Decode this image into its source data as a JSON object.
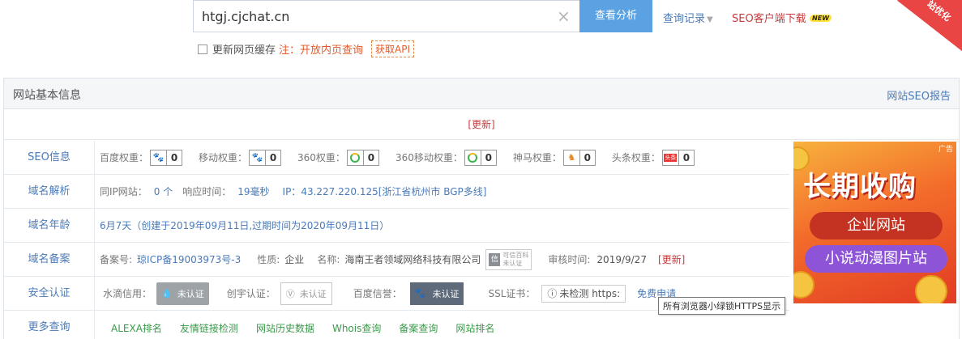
{
  "search": {
    "value": "htgj.cjchat.cn",
    "analyze_label": "查看分析",
    "history_label": "查询记录",
    "seo_client_label": "SEO客户端下载",
    "new_badge": "NEW",
    "corner_label": "站优化"
  },
  "options": {
    "refresh_cache_label": "更新网页缓存",
    "note": "注：开放内页查询",
    "api_label": "获取API"
  },
  "panel": {
    "title": "网站基本信息",
    "seo_report": "网站SEO报告",
    "update_label": "[更新]"
  },
  "seo": {
    "label": "SEO信息",
    "items": [
      {
        "name": "百度权重：",
        "value": "0",
        "icon": "baidu-paw-icon"
      },
      {
        "name": "移动权重：",
        "value": "0",
        "icon": "baidu-paw-icon"
      },
      {
        "name": "360权重：",
        "value": "0",
        "icon": "360-icon"
      },
      {
        "name": "360移动权重：",
        "value": "0",
        "icon": "360-icon"
      },
      {
        "name": "神马权重：",
        "value": "0",
        "icon": "shenma-icon"
      },
      {
        "name": "头条权重：",
        "value": "0",
        "icon": "toutiao-icon"
      }
    ],
    "toutiao_icon_text": "头条"
  },
  "dns": {
    "label": "域名解析",
    "same_ip_label": "同IP网站：",
    "same_ip_value": "0 个",
    "response_label": "响应时间：",
    "response_value": "19毫秒",
    "ip_label": "IP：",
    "ip_value": "43.227.220.125[浙江省杭州市 BGP多线]"
  },
  "age": {
    "label": "域名年龄",
    "value": "6月7天（创建于2019年09月11日,过期时间为2020年09月11日）"
  },
  "icp": {
    "label": "域名备案",
    "number_label": "备案号:",
    "number_value": "琼ICP备19003973号-3",
    "nature_label": "性质:",
    "nature_value": "企业",
    "name_label": "名称:",
    "name_value": "海南王者领域网络科技有限公司",
    "kexin_line1": "可信百科",
    "kexin_line2": "未认证",
    "review_label": "审核时间:",
    "review_value": "2019/9/27",
    "update_label": "[更新]"
  },
  "security": {
    "label": "安全认证",
    "shuidi_label": "水滴信用：",
    "shuidi_badge": "未认证",
    "chuangyu_label": "创宇认证：",
    "chuangyu_badge": "未认证",
    "baidu_label": "百度信誉：",
    "baidu_badge": "未认证",
    "ssl_label": "SSL证书：",
    "ssl_value": "未检测 https:",
    "free_apply": "免费申请",
    "tooltip": "所有浏览器小绿锁HTTPS显示"
  },
  "more": {
    "label": "更多查询",
    "links": [
      "ALEXA排名",
      "友情链接检测",
      "网站历史数据",
      "Whois查询",
      "备案查询",
      "网站排名"
    ]
  },
  "ad": {
    "title": "长期收购",
    "pill1": "企业网站",
    "pill2": "小说动漫图片站",
    "close": "广告"
  }
}
